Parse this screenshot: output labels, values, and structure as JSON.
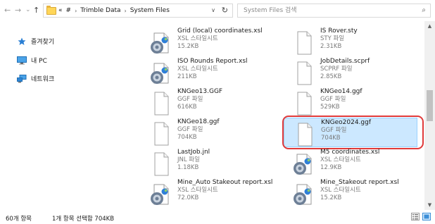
{
  "toolbar": {
    "back": "←",
    "forward": "→",
    "recent": "⌄",
    "up": "↑"
  },
  "address": {
    "overflow": "«",
    "crumbs": [
      "#",
      "Trimble Data",
      "System Files"
    ],
    "separator": "›"
  },
  "search": {
    "placeholder": "System Files 검색"
  },
  "nav": {
    "quick_access": "즐겨찾기",
    "this_pc": "내 PC",
    "network": "네트워크"
  },
  "files": [
    {
      "name": "Grid (local) coordinates.xsl",
      "type": "XSL 스타일시트",
      "size": "15.2KB",
      "icon": "xsl-stylesheet-icon"
    },
    {
      "name": "IS Rover.sty",
      "type": "STY 파일",
      "size": "2.31KB",
      "icon": "generic-file-icon"
    },
    {
      "name": "ISO Rounds Report.xsl",
      "type": "XSL 스타일시트",
      "size": "211KB",
      "icon": "xsl-stylesheet-icon"
    },
    {
      "name": "JobDetails.scprf",
      "type": "SCPRF 파일",
      "size": "2.85KB",
      "icon": "generic-file-icon"
    },
    {
      "name": "KNGeo13.GGF",
      "type": "GGF 파일",
      "size": "616KB",
      "icon": "generic-file-icon"
    },
    {
      "name": "KNGeo14.ggf",
      "type": "GGF 파일",
      "size": "529KB",
      "icon": "generic-file-icon"
    },
    {
      "name": "KNGeo18.ggf",
      "type": "GGF 파일",
      "size": "704KB",
      "icon": "generic-file-icon"
    },
    {
      "name": "KNGeo2024.ggf",
      "type": "GGF 파일",
      "size": "704KB",
      "icon": "generic-file-icon",
      "selected": true
    },
    {
      "name": "LastJob.jnl",
      "type": "JNL 파일",
      "size": "1.18KB",
      "icon": "generic-file-icon"
    },
    {
      "name": "M5 coordinates.xsl",
      "type": "XSL 스타일시트",
      "size": "12.9KB",
      "icon": "xsl-stylesheet-icon"
    },
    {
      "name": "Mine_Auto Stakeout report.xsl",
      "type": "XSL 스타일시트",
      "size": "72.0KB",
      "icon": "xsl-stylesheet-icon"
    },
    {
      "name": "Mine_Stakeout report.xsl",
      "type": "XSL 스타일시트",
      "size": "15.2KB",
      "icon": "xsl-stylesheet-icon"
    }
  ],
  "status": {
    "item_count": "60개 항목",
    "selection": "1개 항목 선택함 704KB"
  },
  "colors": {
    "selection_bg": "#cce8ff",
    "selection_border": "#99d1ff",
    "highlight_ring": "#e03a3a",
    "folder": "#ffd658"
  }
}
